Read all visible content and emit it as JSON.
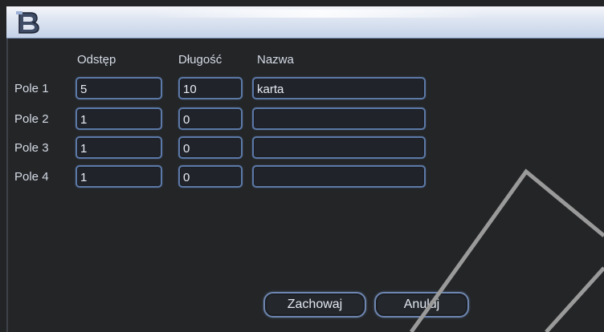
{
  "headers": {
    "offset": "Odstęp",
    "length": "Długość",
    "name": "Nazwa"
  },
  "rows": [
    {
      "label": "Pole 1",
      "offset": "5",
      "length": "10",
      "name": "karta"
    },
    {
      "label": "Pole 2",
      "offset": "1",
      "length": "0",
      "name": ""
    },
    {
      "label": "Pole 3",
      "offset": "1",
      "length": "0",
      "name": ""
    },
    {
      "label": "Pole 4",
      "offset": "1",
      "length": "0",
      "name": ""
    }
  ],
  "buttons": {
    "save": "Zachowaj",
    "cancel": "Anuluj"
  },
  "icons": {
    "app_logo": "app-logo-icon"
  },
  "colors": {
    "background": "#232527",
    "field_border": "#5c79a8",
    "text": "#d6dbe6"
  }
}
